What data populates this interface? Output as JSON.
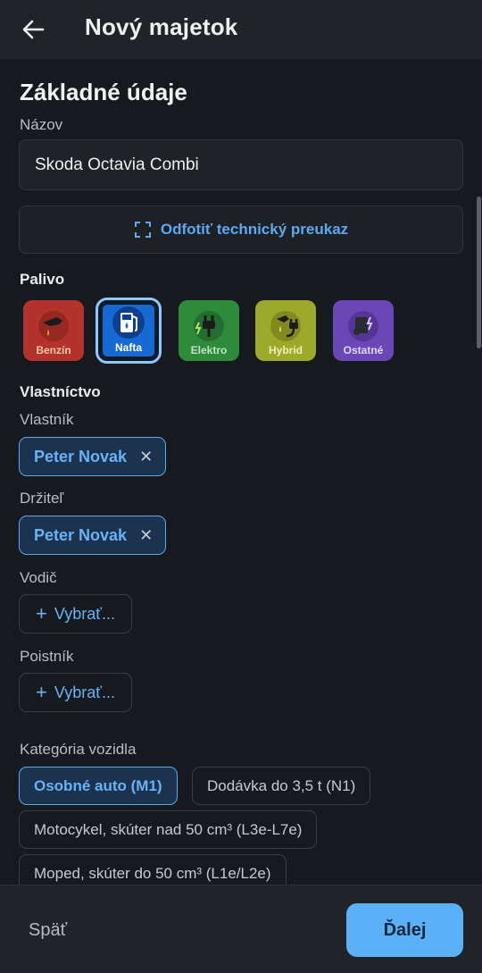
{
  "appbar": {
    "title": "Nový majetok",
    "back_icon": "arrow-left-icon"
  },
  "basic": {
    "section_title": "Základné údaje",
    "name_label": "Názov",
    "name_value": "Skoda Octavia Combi",
    "scan_label": "Odfotiť technický preukaz",
    "scan_icon": "scan-frame-icon"
  },
  "fuel": {
    "label": "Palivo",
    "options": [
      {
        "label": "Benzín",
        "icon": "fuel-nozzle-icon",
        "color": "#b3322c",
        "selected": false
      },
      {
        "label": "Nafta",
        "icon": "fuel-pump-icon",
        "color": "#1769d6",
        "selected": true
      },
      {
        "label": "Elektro",
        "icon": "plug-icon",
        "color": "#2e8b3c",
        "selected": false
      },
      {
        "label": "Hybrid",
        "icon": "hybrid-plug-icon",
        "color": "#9da92b",
        "selected": false
      },
      {
        "label": "Ostatné",
        "icon": "other-fuel-icon",
        "color": "#6b46b6",
        "selected": false
      }
    ]
  },
  "ownership": {
    "section_label": "Vlastníctvo",
    "owner_label": "Vlastník",
    "owner_value": "Peter Novak",
    "holder_label": "Držiteľ",
    "holder_value": "Peter Novak",
    "driver_label": "Vodič",
    "driver_button": "Vybrať...",
    "insurer_label": "Poistník",
    "insurer_button": "Vybrať..."
  },
  "category": {
    "label": "Kategória vozidla",
    "options": [
      {
        "label": "Osobné auto (M1)",
        "selected": true
      },
      {
        "label": "Dodávka do 3,5 t (N1)",
        "selected": false
      },
      {
        "label": "Motocykel, skúter nad 50 cm³ (L3e-L7e)",
        "selected": false
      },
      {
        "label": "Moped, skúter do 50 cm³ (L1e/L2e)",
        "selected": false
      }
    ]
  },
  "footer": {
    "back_label": "Späť",
    "next_label": "Ďalej"
  },
  "colors": {
    "accent": "#5ab1f7",
    "background": "#16191d",
    "surface": "#202328"
  }
}
